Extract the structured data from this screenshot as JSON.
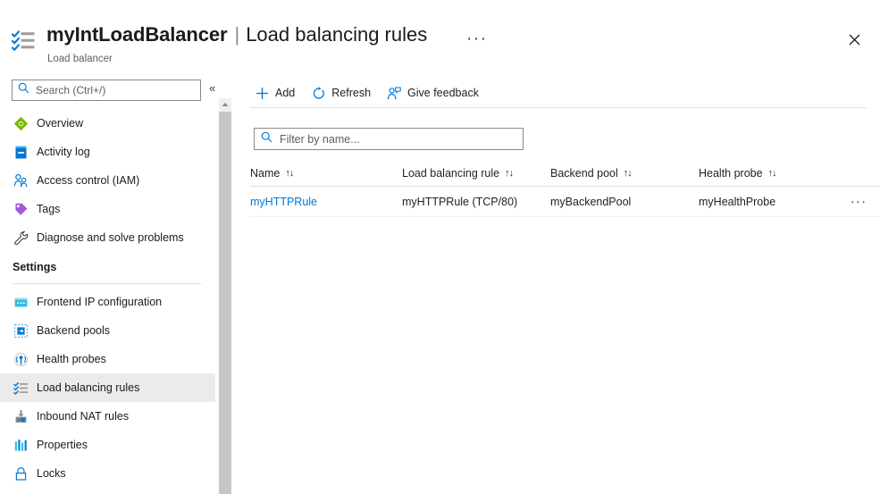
{
  "header": {
    "icon": "load-balancing-rules-checklist-icon",
    "resource_name": "myIntLoadBalancer",
    "separator": "|",
    "page_name": "Load balancing rules",
    "ellipsis": "···",
    "subtitle": "Load balancer",
    "close_icon": "close-icon"
  },
  "sidebar": {
    "search": {
      "placeholder": "Search (Ctrl+/)",
      "value": "",
      "icon": "search-icon"
    },
    "collapse_icon": "«",
    "items": [
      {
        "label": "Overview",
        "icon": "overview-diamond-icon",
        "selected": false
      },
      {
        "label": "Activity log",
        "icon": "activity-log-icon",
        "selected": false
      },
      {
        "label": "Access control (IAM)",
        "icon": "access-control-people-icon",
        "selected": false
      },
      {
        "label": "Tags",
        "icon": "tags-icon",
        "selected": false
      },
      {
        "label": "Diagnose and solve problems",
        "icon": "wrench-icon",
        "selected": false
      }
    ],
    "settings_label": "Settings",
    "settings_items": [
      {
        "label": "Frontend IP configuration",
        "icon": "frontend-ip-icon",
        "selected": false
      },
      {
        "label": "Backend pools",
        "icon": "backend-pools-icon",
        "selected": false
      },
      {
        "label": "Health probes",
        "icon": "health-probes-icon",
        "selected": false
      },
      {
        "label": "Load balancing rules",
        "icon": "load-balancing-rules-icon",
        "selected": true
      },
      {
        "label": "Inbound NAT rules",
        "icon": "inbound-nat-rules-icon",
        "selected": false
      },
      {
        "label": "Properties",
        "icon": "properties-icon",
        "selected": false
      },
      {
        "label": "Locks",
        "icon": "locks-padlock-icon",
        "selected": false
      }
    ],
    "scrollbar": {
      "up_arrow_icon": "scroll-up-arrow-icon"
    }
  },
  "toolbar": {
    "buttons": [
      {
        "label": "Add",
        "icon": "plus-icon"
      },
      {
        "label": "Refresh",
        "icon": "refresh-icon"
      },
      {
        "label": "Give feedback",
        "icon": "give-feedback-person-icon"
      }
    ]
  },
  "filter": {
    "placeholder": "Filter by name...",
    "value": "",
    "icon": "search-icon"
  },
  "table": {
    "sort_icon": "↑↓",
    "columns": [
      {
        "label": "Name"
      },
      {
        "label": "Load balancing rule"
      },
      {
        "label": "Backend pool"
      },
      {
        "label": "Health probe"
      }
    ],
    "rows": [
      {
        "name": "myHTTPRule",
        "load_balancing_rule": "myHTTPRule (TCP/80)",
        "backend_pool": "myBackendPool",
        "health_probe": "myHealthProbe",
        "more_icon": "···"
      }
    ]
  },
  "colors": {
    "accent": "#0078d4",
    "link": "#0078d4",
    "selected_row_bg": "#edebe9",
    "text": "#201f1e",
    "subtle_text": "#605e5c",
    "border": "#e1dfdd"
  }
}
